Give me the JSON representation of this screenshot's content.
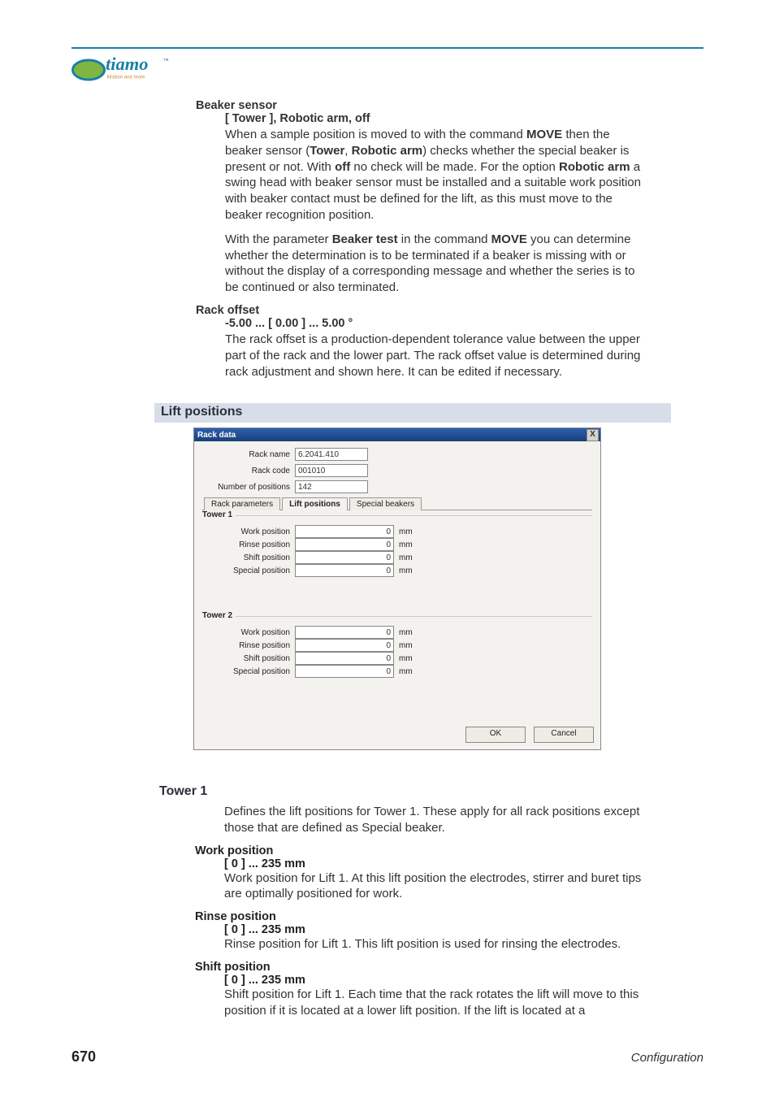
{
  "logo": {
    "brand": "tiamo",
    "tagline": "titration and more"
  },
  "beaker": {
    "heading": "Beaker sensor",
    "range": "[ Tower ], Robotic arm, off",
    "p1_a": "When a sample position is moved to with the command ",
    "p1_move": "MOVE",
    "p1_b": " then the beaker sensor (",
    "p1_tower": "Tower",
    "p1_c": ", ",
    "p1_robotic": "Robotic arm",
    "p1_d": ") checks whether the special beaker is present or not. With ",
    "p1_off": "off",
    "p1_e": " no check will be made. For the option ",
    "p1_robotic2": "Robotic arm",
    "p1_f": " a swing head with beaker sensor must be installed and a suitable work position with beaker contact must be defined for the lift, as this must move to the beaker recognition position.",
    "p2_a": "With the parameter ",
    "p2_bt": "Beaker test",
    "p2_b": " in the command ",
    "p2_move": "MOVE",
    "p2_c": " you can determine whether the determination is to be terminated if a beaker is missing with or without the display of a corresponding message and whether the series is to be continued or also terminated."
  },
  "rackoffset": {
    "heading": "Rack offset",
    "range": "-5.00 ... [ 0.00 ] ... 5.00 °",
    "p": "The rack offset is a production-dependent tolerance value between the upper part of the rack and the lower part. The rack offset value is determined during rack adjustment and shown here. It can be edited if necessary."
  },
  "section_lift": "Lift positions",
  "dialog": {
    "title": "Rack data",
    "close": "X",
    "rows": {
      "rackname_label": "Rack name",
      "rackname_value": "6.2041.410",
      "rackcode_label": "Rack code",
      "rackcode_value": "001010",
      "numpos_label": "Number of positions",
      "numpos_value": "142"
    },
    "tabs": {
      "t1": "Rack parameters",
      "t2": "Lift positions",
      "t3": "Special beakers"
    },
    "tower1": {
      "title": "Tower 1",
      "work": {
        "label": "Work position",
        "value": "0",
        "unit": "mm"
      },
      "rinse": {
        "label": "Rinse position",
        "value": "0",
        "unit": "mm"
      },
      "shift": {
        "label": "Shift position",
        "value": "0",
        "unit": "mm"
      },
      "special": {
        "label": "Special position",
        "value": "0",
        "unit": "mm"
      }
    },
    "tower2": {
      "title": "Tower 2",
      "work": {
        "label": "Work position",
        "value": "0",
        "unit": "mm"
      },
      "rinse": {
        "label": "Rinse position",
        "value": "0",
        "unit": "mm"
      },
      "shift": {
        "label": "Shift position",
        "value": "0",
        "unit": "mm"
      },
      "special": {
        "label": "Special position",
        "value": "0",
        "unit": "mm"
      }
    },
    "buttons": {
      "ok": "OK",
      "cancel": "Cancel"
    }
  },
  "tower1_section": {
    "heading": "Tower 1",
    "intro": "Defines the lift positions for Tower 1. These apply for all rack positions except those that are defined as Special beaker.",
    "work": {
      "label": "Work position",
      "range": "[ 0 ] ... 235 mm",
      "text": "Work position for Lift 1. At this lift position the electrodes, stirrer and buret tips are optimally positioned for work."
    },
    "rinse": {
      "label": "Rinse position",
      "range": "[ 0 ] ... 235 mm",
      "text": "Rinse position for Lift 1. This lift position is used for rinsing the electrodes."
    },
    "shift": {
      "label": "Shift position",
      "range": "[ 0 ] ... 235 mm",
      "text": "Shift position for Lift 1. Each time that the rack rotates the lift will move to this position if it is located at a lower lift position. If the lift is located at a"
    }
  },
  "footer": {
    "page": "670",
    "section": "Configuration"
  }
}
